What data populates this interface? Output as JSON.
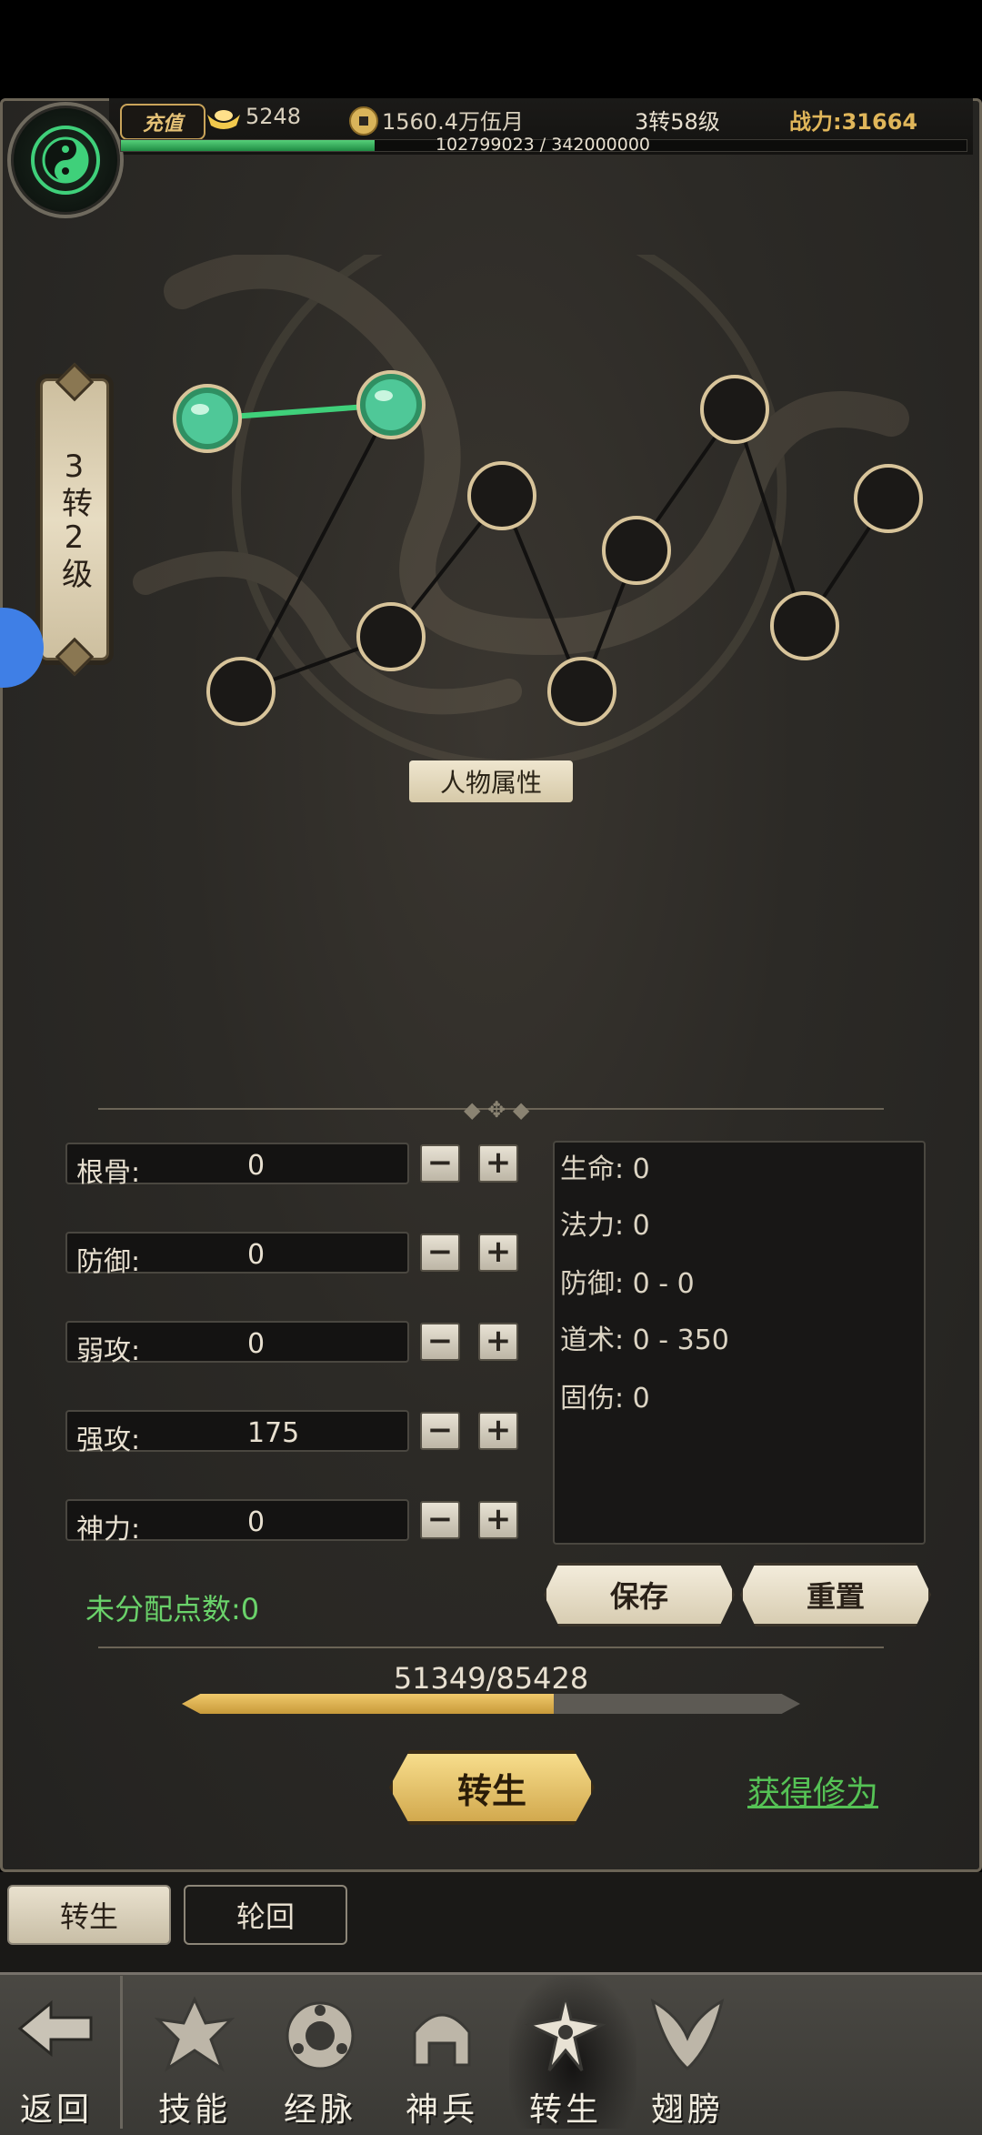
{
  "header": {
    "recharge_label": "充值",
    "ingot_value": "5248",
    "coin_value": "1560.4万伍月",
    "rebirth_level": "3转58级",
    "power_label": "战力:",
    "power_value": "31664",
    "exp_text": "102799023 / 342000000",
    "exp_fraction": 0.3
  },
  "level_banner": {
    "text": "3转2级"
  },
  "attribute_tag": "人物属性",
  "graph": {
    "active_color": "#3fd07a",
    "node_count": 11,
    "activated_nodes": 2
  },
  "stats": [
    {
      "label": "根骨:",
      "value": "0"
    },
    {
      "label": "防御:",
      "value": "0"
    },
    {
      "label": "弱攻:",
      "value": "0"
    },
    {
      "label": "强攻:",
      "value": "175"
    },
    {
      "label": "神力:",
      "value": "0"
    }
  ],
  "results": [
    "生命: 0",
    "法力: 0",
    "防御: 0 - 0",
    "道术: 0 - 350",
    "固伤: 0"
  ],
  "unassigned_points": "未分配点数:0",
  "buttons": {
    "save": "保存",
    "reset": "重置",
    "rebirth": "转生",
    "gain_cultivation": "获得修为"
  },
  "progress": {
    "text": "51349/85428",
    "fraction": 0.601
  },
  "tabs": {
    "active": "转生",
    "inactive": "轮回"
  },
  "nav": {
    "back": "返回",
    "items": [
      "技能",
      "经脉",
      "神兵",
      "转生",
      "翅膀"
    ],
    "active_index": 3
  },
  "colors": {
    "gold": "#e0b65a",
    "green_text": "#6ad26a",
    "panel": "#2c2a26"
  }
}
